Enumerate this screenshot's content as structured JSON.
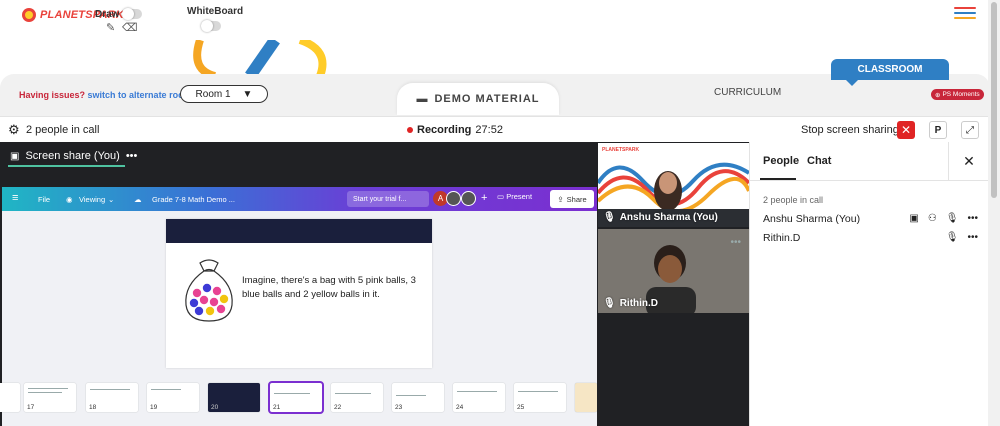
{
  "app": {
    "logo_text": "PLANETSPARK",
    "draw_label": "Draw",
    "whiteboard_label": "WhiteBoard"
  },
  "controls": {
    "issues_text": "Having issues?",
    "alternate_link": "switch to alternate room",
    "room_value": "Room 1",
    "demo_material": "DEMO MATERIAL",
    "curriculum": "CURRICULUM",
    "classroom": "CLASSROOM",
    "ps_moments": "PS Moments"
  },
  "call": {
    "people_count": "2 people in call",
    "recording_label": "Recording",
    "recording_time": "27:52",
    "stop_sharing": "Stop screen sharing",
    "p_button": "P"
  },
  "share": {
    "title": "Screen share (You)",
    "menu": "•••",
    "canva": {
      "file": "File",
      "viewing": "Viewing",
      "doc_title": "Grade 7-8 Math Demo ...",
      "trial": "Start your trial f...",
      "avatar_letter": "A",
      "plus": "+",
      "present": "Present",
      "share": "Share"
    },
    "slide_text": "Imagine, there's a bag with 5 pink balls, 3 blue balls and 2 yellow balls in it.",
    "thumbnails": [
      "17",
      "18",
      "19",
      "20",
      "21",
      "22",
      "23",
      "24",
      "25"
    ],
    "selected_thumbnail": "21"
  },
  "videos": [
    {
      "name": "Anshu Sharma (You)",
      "watermark": "PLANETSPARK"
    },
    {
      "name": "Rithin.D"
    }
  ],
  "panel": {
    "tab_people": "People",
    "tab_chat": "Chat",
    "in_call": "2 people in call",
    "people": [
      {
        "name": "Anshu Sharma (You)"
      },
      {
        "name": "Rithin.D"
      }
    ]
  },
  "colors": {
    "brand_red": "#e9423b",
    "classroom_blue": "#2f7fc4",
    "record_red": "#e02424"
  }
}
